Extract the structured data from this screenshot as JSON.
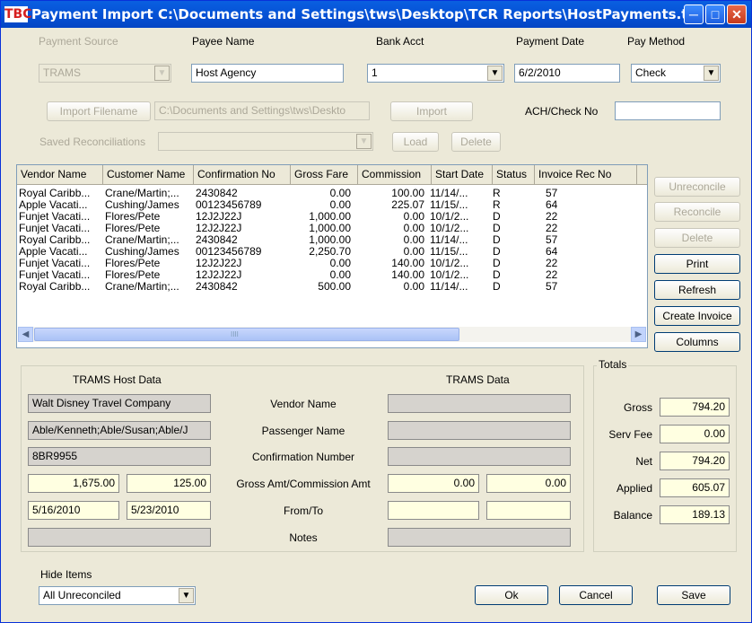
{
  "window": {
    "logo": "TBC",
    "title": "Payment Import C:\\Documents and Settings\\tws\\Desktop\\TCR Reports\\HostPayments.txt"
  },
  "top": {
    "payment_source_label": "Payment Source",
    "payment_source_value": "TRAMS",
    "payee_name_label": "Payee Name",
    "payee_name_value": "Host Agency",
    "bank_acct_label": "Bank Acct",
    "bank_acct_value": "1",
    "payment_date_label": "Payment Date",
    "payment_date_value": "6/2/2010",
    "pay_method_label": "Pay Method",
    "pay_method_value": "Check",
    "import_filename_button": "Import Filename",
    "import_filename_value": "C:\\Documents and Settings\\tws\\Deskto",
    "import_button": "Import",
    "ach_check_label": "ACH/Check No",
    "ach_check_value": "",
    "saved_recon_label": "Saved Reconciliations",
    "saved_recon_value": "",
    "load_button": "Load",
    "delete_button": "Delete"
  },
  "table": {
    "columns": [
      "Vendor Name",
      "Customer Name",
      "Confirmation No",
      "Gross Fare",
      "Commission",
      "Start Date",
      "Status",
      "Invoice Rec No"
    ],
    "rows": [
      [
        "Royal Caribb...",
        "Crane/Martin;...",
        "2430842",
        "0.00",
        "100.00",
        "11/14/...",
        "R",
        "57"
      ],
      [
        "Apple Vacati...",
        "Cushing/James",
        "00123456789",
        "0.00",
        "225.07",
        "11/15/...",
        "R",
        "64"
      ],
      [
        "Funjet Vacati...",
        "Flores/Pete",
        "12J2J22J",
        "1,000.00",
        "0.00",
        "10/1/2...",
        "D",
        "22"
      ],
      [
        "Funjet Vacati...",
        "Flores/Pete",
        "12J2J22J",
        "1,000.00",
        "0.00",
        "10/1/2...",
        "D",
        "22"
      ],
      [
        "Royal Caribb...",
        "Crane/Martin;...",
        "2430842",
        "1,000.00",
        "0.00",
        "11/14/...",
        "D",
        "57"
      ],
      [
        "Apple Vacati...",
        "Cushing/James",
        "00123456789",
        "2,250.70",
        "0.00",
        "11/15/...",
        "D",
        "64"
      ],
      [
        "Funjet Vacati...",
        "Flores/Pete",
        "12J2J22J",
        "0.00",
        "140.00",
        "10/1/2...",
        "D",
        "22"
      ],
      [
        "Funjet Vacati...",
        "Flores/Pete",
        "12J2J22J",
        "0.00",
        "140.00",
        "10/1/2...",
        "D",
        "22"
      ],
      [
        "Royal Caribb...",
        "Crane/Martin;...",
        "2430842",
        "500.00",
        "0.00",
        "11/14/...",
        "D",
        "57"
      ]
    ],
    "scroll_grip": "IIII"
  },
  "side_buttons": {
    "unreconcile": "Unreconcile",
    "reconcile": "Reconcile",
    "delete": "Delete",
    "print": "Print",
    "refresh": "Refresh",
    "create_invoice": "Create Invoice",
    "columns": "Columns"
  },
  "detail": {
    "host_header": "TRAMS Host Data",
    "trams_header": "TRAMS Data",
    "labels": {
      "vendor_name": "Vendor Name",
      "passenger_name": "Passenger Name",
      "confirmation_number": "Confirmation Number",
      "gross_comm": "Gross Amt/Commission Amt",
      "from_to": "From/To",
      "notes": "Notes"
    },
    "host": {
      "vendor_name": "Walt Disney Travel Company",
      "passenger_name": "Able/Kenneth;Able/Susan;Able/J",
      "confirmation_number": "8BR9955",
      "gross_amt": "1,675.00",
      "commission_amt": "125.00",
      "from": "5/16/2010",
      "to": "5/23/2010",
      "notes": ""
    },
    "trams": {
      "vendor_name": "",
      "passenger_name": "",
      "confirmation_number": "",
      "gross_amt": "0.00",
      "commission_amt": "0.00",
      "from": "",
      "to": "",
      "notes": ""
    }
  },
  "totals": {
    "title": "Totals",
    "gross_label": "Gross",
    "gross_value": "794.20",
    "serv_fee_label": "Serv Fee",
    "serv_fee_value": "0.00",
    "net_label": "Net",
    "net_value": "794.20",
    "applied_label": "Applied",
    "applied_value": "605.07",
    "balance_label": "Balance",
    "balance_value": "189.13"
  },
  "bottom": {
    "hide_items_label": "Hide Items",
    "hide_items_value": "All Unreconciled",
    "ok_button": "Ok",
    "cancel_button": "Cancel",
    "save_button": "Save"
  }
}
